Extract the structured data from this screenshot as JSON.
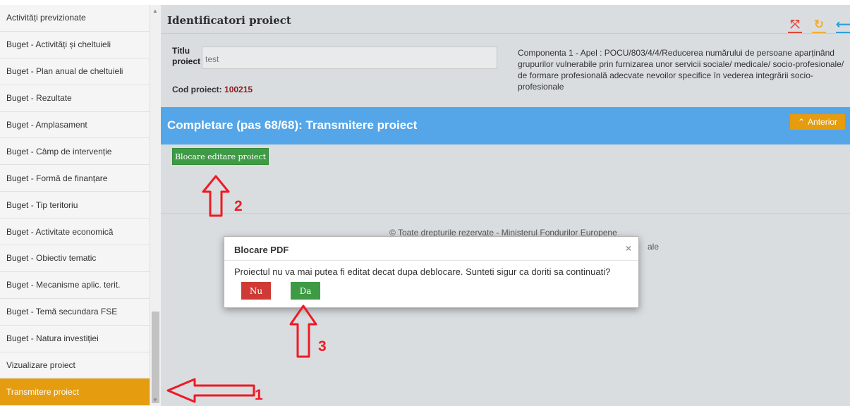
{
  "sidebar": {
    "items": [
      {
        "label": "Activități previzionate"
      },
      {
        "label": "Buget - Activități și cheltuieli"
      },
      {
        "label": "Buget - Plan anual de cheltuieli"
      },
      {
        "label": "Buget - Rezultate"
      },
      {
        "label": "Buget - Amplasament"
      },
      {
        "label": "Buget - Câmp de intervenție"
      },
      {
        "label": "Buget - Formă de finanțare"
      },
      {
        "label": "Buget - Tip teritoriu"
      },
      {
        "label": "Buget - Activitate economică"
      },
      {
        "label": "Buget - Obiectiv tematic"
      },
      {
        "label": "Buget - Mecanisme aplic. terit."
      },
      {
        "label": "Buget - Temă secundara FSE"
      },
      {
        "label": "Buget - Natura investiției"
      },
      {
        "label": "Vizualizare proiect"
      },
      {
        "label": "Transmitere proiect"
      }
    ],
    "active_index": 14
  },
  "header": {
    "title": "Identificatori proiect",
    "icons": [
      "expand-icon",
      "refresh-icon",
      "arrow-icon"
    ]
  },
  "project": {
    "titlu_label": "Titlu proiect",
    "titlu_value": "test",
    "cod_label": "Cod proiect:",
    "cod_value": "100215",
    "componenta": "Componenta 1 - Apel : POCU/803/4/4/Reducerea numărului de persoane aparținând grupurilor vulnerabile prin furnizarea unor servicii sociale/ medicale/ socio-profesionale/ de formare profesională adecvate nevoilor specifice în vederea integrării socio-profesionale"
  },
  "step": {
    "title": "Completare (pas 68/68): Transmitere proiect",
    "anterior_label": "Anterior"
  },
  "actions": {
    "blocare_label": "Blocare editare proiect"
  },
  "footer": {
    "line1": "© Toate drepturile rezervate - Ministerul Fondurilor Europene",
    "line2": "ale"
  },
  "modal": {
    "title": "Blocare PDF",
    "close": "×",
    "message": "Proiectul nu va mai putea fi editat decat dupa deblocare. Sunteti sigur ca doriti sa continuati?",
    "nu_label": "Nu",
    "da_label": "Da"
  },
  "annotations": {
    "step1": "1",
    "step2": "2",
    "step3": "3",
    "color": "#ee1a24"
  },
  "colors": {
    "active_sidebar": "#e59c0f",
    "step_bar": "#55a6e8",
    "green_button": "#3f9a45",
    "red_button": "#cf3a35",
    "cod_value": "#8f1c1c"
  }
}
